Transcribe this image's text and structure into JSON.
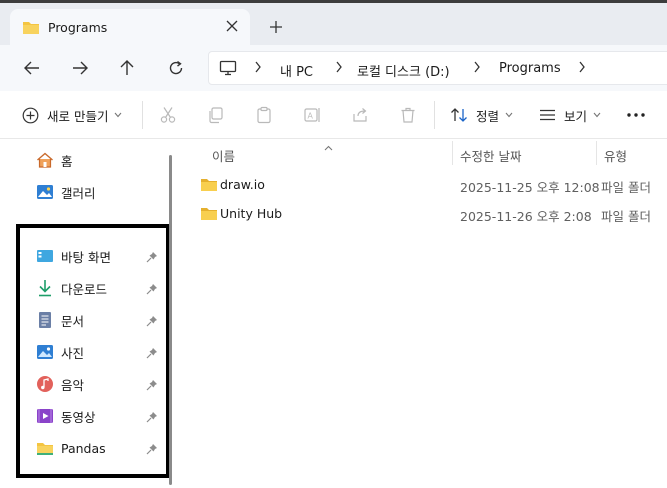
{
  "window": {
    "tab_title": "Programs",
    "tab_close_icon": "close-icon",
    "new_tab_icon": "plus-icon"
  },
  "nav": {
    "back_icon": "arrow-left-icon",
    "forward_icon": "arrow-right-icon",
    "up_icon": "arrow-up-icon",
    "refresh_icon": "refresh-icon"
  },
  "address": {
    "segments": [
      "내 PC",
      "로컬 디스크 (D:)",
      "Programs"
    ]
  },
  "toolbar": {
    "new_label": "새로 만들기",
    "sort_label": "정렬",
    "view_label": "보기",
    "more_icon": "ellipsis-icon"
  },
  "sidebar": {
    "home": "홈",
    "gallery": "갤러리",
    "quick": [
      {
        "label": "바탕 화면",
        "icon": "desktop-icon"
      },
      {
        "label": "다운로드",
        "icon": "download-icon"
      },
      {
        "label": "문서",
        "icon": "document-icon"
      },
      {
        "label": "사진",
        "icon": "pictures-icon"
      },
      {
        "label": "음악",
        "icon": "music-icon"
      },
      {
        "label": "동영상",
        "icon": "video-icon"
      },
      {
        "label": "Pandas",
        "icon": "folder-icon"
      }
    ]
  },
  "list": {
    "columns": {
      "name": "이름",
      "date": "수정한 날짜",
      "type": "유형"
    },
    "rows": [
      {
        "name": "draw.io",
        "date": "2025-11-25 오후 12:08",
        "type": "파일 폴더"
      },
      {
        "name": "Unity Hub",
        "date": "2025-11-26 오후 2:08",
        "type": "파일 폴더"
      }
    ]
  },
  "colors": {
    "folder": "#f4c542",
    "titlebar": "#e9ecf1",
    "highlight_border": "#000000"
  }
}
